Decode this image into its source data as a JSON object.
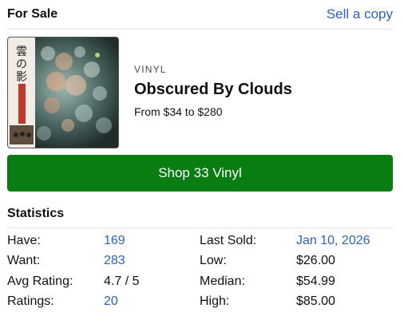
{
  "for_sale": {
    "title": "For Sale",
    "sell_link": "Sell a copy"
  },
  "release": {
    "format": "VINYL",
    "title": "Obscured By Clouds",
    "price_range": "From $34 to $280",
    "cover_text": "雲の影"
  },
  "shop_button": "Shop 33 Vinyl",
  "statistics": {
    "title": "Statistics",
    "left": [
      {
        "label": "Have:",
        "value": "169",
        "link": true
      },
      {
        "label": "Want:",
        "value": "283",
        "link": true
      },
      {
        "label": "Avg Rating:",
        "value": "4.7 / 5",
        "link": false
      },
      {
        "label": "Ratings:",
        "value": "20",
        "link": true
      }
    ],
    "right": [
      {
        "label": "Last Sold:",
        "value": "Jan 10, 2026",
        "link": true
      },
      {
        "label": "Low:",
        "value": "$26.00",
        "link": false
      },
      {
        "label": "Median:",
        "value": "$54.99",
        "link": false
      },
      {
        "label": "High:",
        "value": "$85.00",
        "link": false
      }
    ]
  },
  "colors": {
    "link": "#2b62c8",
    "shop_button": "#097d11"
  }
}
